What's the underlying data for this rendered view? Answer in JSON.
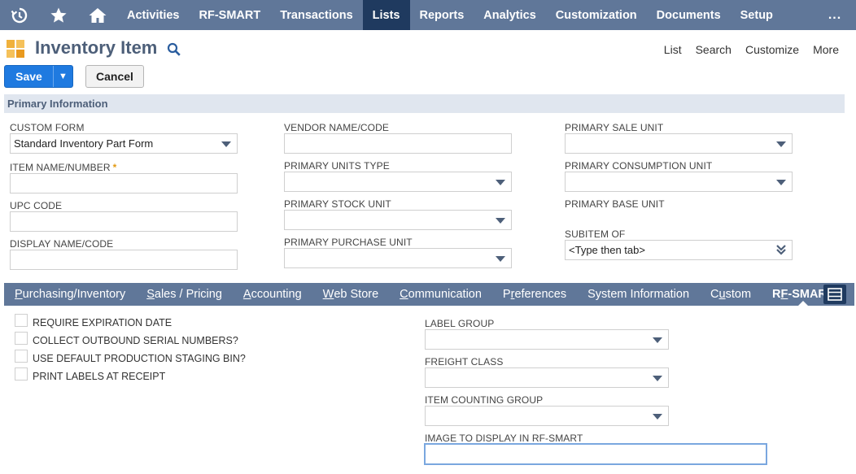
{
  "nav": {
    "items": [
      {
        "label": "Activities"
      },
      {
        "label": "RF-SMART"
      },
      {
        "label": "Transactions"
      },
      {
        "label": "Lists"
      },
      {
        "label": "Reports"
      },
      {
        "label": "Analytics"
      },
      {
        "label": "Customization"
      },
      {
        "label": "Documents"
      },
      {
        "label": "Setup"
      }
    ],
    "more": "...",
    "active": "Lists"
  },
  "header": {
    "title": "Inventory Item",
    "links": [
      "List",
      "Search",
      "Customize",
      "More"
    ]
  },
  "buttons": {
    "save": "Save",
    "cancel": "Cancel"
  },
  "primary": {
    "section_title": "Primary Information",
    "custom_form": {
      "label": "CUSTOM FORM",
      "value": "Standard Inventory Part Form"
    },
    "item_name": {
      "label": "ITEM NAME/NUMBER",
      "required": "*",
      "value": ""
    },
    "upc_code": {
      "label": "UPC CODE",
      "value": ""
    },
    "display_name": {
      "label": "DISPLAY NAME/CODE",
      "value": ""
    },
    "vendor_name": {
      "label": "VENDOR NAME/CODE",
      "value": ""
    },
    "units_type": {
      "label": "PRIMARY UNITS TYPE",
      "value": ""
    },
    "stock_unit": {
      "label": "PRIMARY STOCK UNIT",
      "value": ""
    },
    "purchase_unit": {
      "label": "PRIMARY PURCHASE UNIT",
      "value": ""
    },
    "sale_unit": {
      "label": "PRIMARY SALE UNIT",
      "value": ""
    },
    "consumption_unit": {
      "label": "PRIMARY CONSUMPTION UNIT",
      "value": ""
    },
    "base_unit": {
      "label": "PRIMARY BASE UNIT"
    },
    "subitem_of": {
      "label": "SUBITEM OF",
      "value": "<Type then tab>"
    }
  },
  "tabs": [
    {
      "pre": "",
      "u": "P",
      "post": "urchasing/Inventory"
    },
    {
      "pre": "",
      "u": "S",
      "post": "ales / Pricing"
    },
    {
      "pre": "",
      "u": "A",
      "post": "ccounting"
    },
    {
      "pre": "",
      "u": "W",
      "post": "eb Store"
    },
    {
      "pre": "",
      "u": "C",
      "post": "ommunication"
    },
    {
      "pre": "P",
      "u": "r",
      "post": "eferences"
    },
    {
      "pre": "System Information",
      "u": "",
      "post": ""
    },
    {
      "pre": "C",
      "u": "u",
      "post": "stom"
    },
    {
      "pre": "R",
      "u": "F",
      "post": "-SMART"
    }
  ],
  "rfsmart": {
    "checkboxes": [
      {
        "label": "REQUIRE EXPIRATION DATE",
        "checked": false
      },
      {
        "label": "COLLECT OUTBOUND SERIAL NUMBERS?",
        "checked": false
      },
      {
        "label": "USE DEFAULT PRODUCTION STAGING BIN?",
        "checked": false
      },
      {
        "label": "PRINT LABELS AT RECEIPT",
        "checked": false
      }
    ],
    "label_group": {
      "label": "LABEL GROUP",
      "value": ""
    },
    "freight_class": {
      "label": "FREIGHT CLASS",
      "value": ""
    },
    "item_counting_group": {
      "label": "ITEM COUNTING GROUP",
      "value": ""
    },
    "image_display": {
      "label": "IMAGE TO DISPLAY IN RF-SMART",
      "value": ""
    }
  },
  "colors": {
    "nav_bg": "#607799",
    "nav_active": "#1f3a5f",
    "save_blue": "#1f7ae0",
    "section_bg": "#e0e6ef",
    "required_star": "#e39b15"
  },
  "icons": [
    "history-icon",
    "star-icon",
    "home-icon",
    "inventory-item-icon",
    "search-icon",
    "collapse-icon"
  ]
}
